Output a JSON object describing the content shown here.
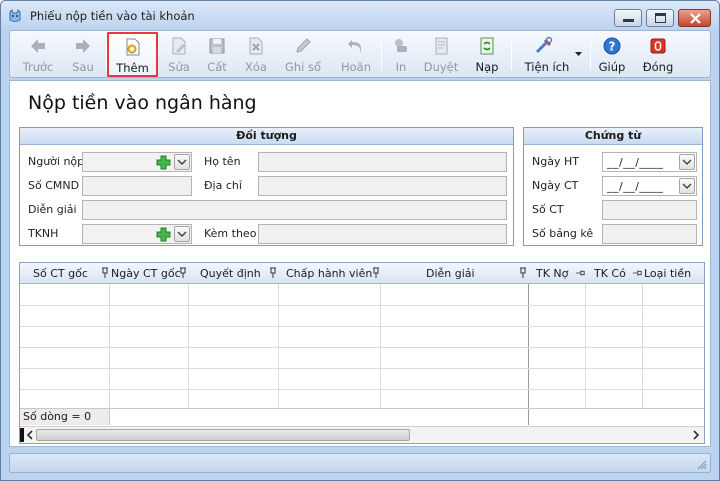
{
  "window": {
    "title": "Phiếu nộp tiền vào tài khoản"
  },
  "toolbar": {
    "items": [
      {
        "label": "Trước",
        "icon": "arrow-left-icon",
        "enabled": false
      },
      {
        "label": "Sau",
        "icon": "arrow-right-icon",
        "enabled": false
      },
      {
        "label": "Thêm",
        "icon": "add-document-icon",
        "enabled": true,
        "highlighted": true
      },
      {
        "label": "Sửa",
        "icon": "edit-document-icon",
        "enabled": false
      },
      {
        "label": "Cất",
        "icon": "save-icon",
        "enabled": false
      },
      {
        "label": "Xóa",
        "icon": "delete-document-icon",
        "enabled": false
      },
      {
        "label": "Ghi sổ",
        "icon": "pencil-icon",
        "enabled": false
      },
      {
        "label": "Hoãn",
        "icon": "undo-icon",
        "enabled": false
      },
      {
        "label": "In",
        "icon": "printer-icon",
        "enabled": false
      },
      {
        "label": "Duyệt",
        "icon": "approve-icon",
        "enabled": false
      },
      {
        "label": "Nạp",
        "icon": "refresh-icon",
        "enabled": true
      },
      {
        "label": "Tiện ích",
        "icon": "tools-icon",
        "enabled": true
      },
      {
        "label": "Giúp",
        "icon": "help-icon",
        "enabled": true
      },
      {
        "label": "Đóng",
        "icon": "close-icon",
        "enabled": true
      }
    ]
  },
  "page": {
    "title": "Nộp tiền vào ngân hàng"
  },
  "doi_tuong": {
    "header": "Đối tượng",
    "nguoi_nop": "Người nộp",
    "so_cmnd": "Số CMND",
    "dien_giai": "Diễn giải",
    "tknh": "TKNH",
    "ho_ten": "Họ tên",
    "dia_chi": "Địa chỉ",
    "kem_theo": "Kèm theo"
  },
  "chung_tu": {
    "header": "Chứng từ",
    "ngay_ht": "Ngày HT",
    "ngay_ct": "Ngày CT",
    "so_ct": "Số CT",
    "so_bang_ke": "Số bảng kê",
    "date_placeholder": "__/__/____"
  },
  "grid": {
    "columns": [
      "Số CT gốc",
      "Ngày CT gốc",
      "Quyết định",
      "Chấp hành viên",
      "Diễn giải",
      "TK Nợ",
      "TK Có",
      "Loại tiền"
    ],
    "row_count_label": "Số dòng = 0"
  },
  "colors": {
    "accent": "#e8383d",
    "chrome": "#bcd4ef"
  }
}
